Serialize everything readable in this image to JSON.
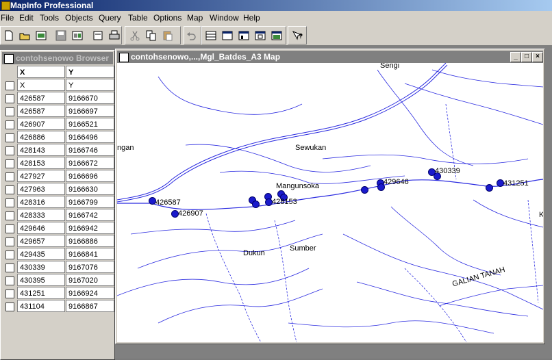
{
  "app": {
    "title": "MapInfo Professional"
  },
  "menu": [
    "File",
    "Edit",
    "Tools",
    "Objects",
    "Query",
    "Table",
    "Options",
    "Map",
    "Window",
    "Help"
  ],
  "browser": {
    "title": "contohsenowo Browser",
    "columns": [
      "X",
      "Y"
    ],
    "rows": [
      [
        "X",
        "Y"
      ],
      [
        "426587",
        "9166670"
      ],
      [
        "426587",
        "9166697"
      ],
      [
        "426907",
        "9166521"
      ],
      [
        "426886",
        "9166496"
      ],
      [
        "428143",
        "9166746"
      ],
      [
        "428153",
        "9166672"
      ],
      [
        "427927",
        "9166696"
      ],
      [
        "427963",
        "9166630"
      ],
      [
        "428316",
        "9166799"
      ],
      [
        "428333",
        "9166742"
      ],
      [
        "429646",
        "9166942"
      ],
      [
        "429657",
        "9166886"
      ],
      [
        "429435",
        "9166841"
      ],
      [
        "430339",
        "9167076"
      ],
      [
        "430395",
        "9167020"
      ],
      [
        "431251",
        "9166924"
      ],
      [
        "431104",
        "9166867"
      ]
    ]
  },
  "map": {
    "title": "contohsenowo,...,Mgl_Batdes_A3 Map",
    "window_buttons": [
      "_",
      "□",
      "×"
    ],
    "place_labels": [
      "Sengi",
      "ngan",
      "Sewukan",
      "Mangunsoka",
      "Sumber",
      "Dukun",
      "GALIAN TANAH",
      "K"
    ],
    "point_labels": [
      "426587",
      "426907",
      "428153",
      "429646",
      "430339",
      "431251"
    ],
    "colors": {
      "river": "#2a2ae0",
      "boundary": "#2a2ae0",
      "point": "#1a1acc"
    }
  }
}
